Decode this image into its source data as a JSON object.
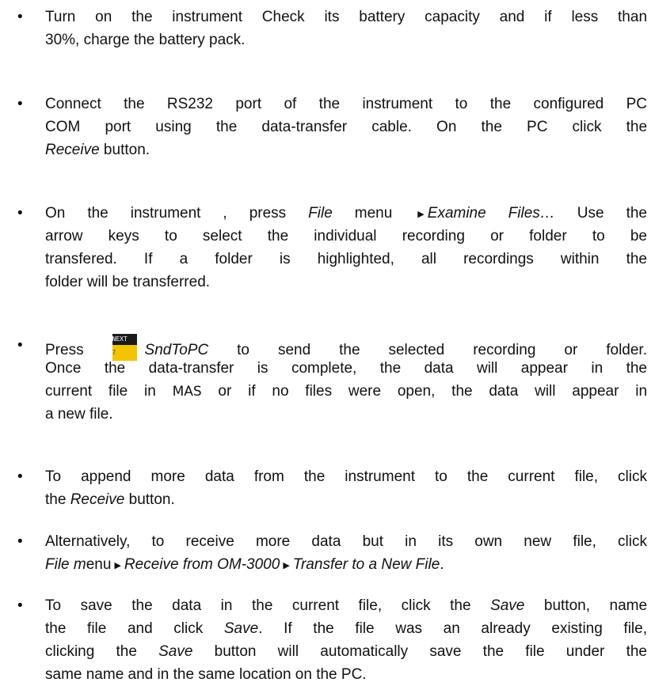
{
  "bullets": [
    {
      "lines": [
        "Turn on the instrument Check its battery capacity and if less than",
        "30%, charge the battery pack."
      ]
    },
    {
      "l1": "Connect the RS232 port of the instrument to the configured PC",
      "l2": "COM port using the data-transfer cable. On the PC click the",
      "l3_italic": "Receive",
      "l3_rest": " button."
    },
    {
      "l1_a": "On the instrument , press ",
      "l1_file": "File",
      "l1_b": " menu ",
      "l1_examine": "Examine Files…",
      "l1_c": " Use the",
      "l2": "arrow keys to select the individual recording or folder to be",
      "l3": "transfered. If a folder is highlighted, all recordings within the",
      "l4": "folder will be transferred."
    },
    {
      "press": "Press",
      "key_top": "NEXT",
      "key_num": "7",
      "snd": "SndToPC",
      "l1_rest": " to send the selected recording or folder.",
      "l2": "Once the data-transfer is complete, the data will appear in the",
      "l3_a": "current file in ",
      "l3_mas": "MAS",
      "l3_b": " or if no files were open, the data will appear in",
      "l4": "a new file."
    },
    {
      "l1": "To append more data from the instrument to the current file, click",
      "l2_a": "the ",
      "l2_receive": "Receive",
      "l2_b": " button."
    },
    {
      "l1": "Alternatively, to receive more data but in its own new file, click",
      "l2_file_i": "File m",
      "l2_file_n": "enu",
      "l2_recv": "Receive from OM-3000",
      "l2_transfer": "Transfer to a New File",
      "l2_end": "."
    },
    {
      "l1_a": "To save the data in the current file, click the ",
      "l1_save": "Save",
      "l1_b": " button, name",
      "l2_a": "the file and click ",
      "l2_save": "Save",
      "l2_b": ". If the file was an already existing file,",
      "l3_a": "clicking the ",
      "l3_save": "Save",
      "l3_b": " button will automatically save the file under the",
      "l4": "same name and in the same location on the PC."
    }
  ]
}
